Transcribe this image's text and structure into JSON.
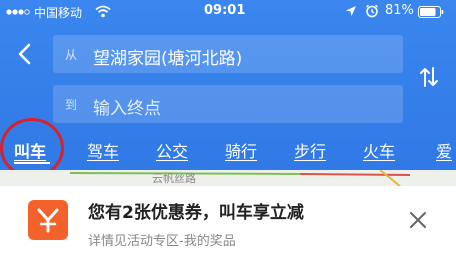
{
  "status_bar": {
    "carrier": "中国移动",
    "time": "09:01",
    "battery": "81%"
  },
  "search": {
    "from_prefix": "从",
    "from_value": "望湖家园(塘河北路)",
    "to_prefix": "到",
    "to_placeholder": "输入终点"
  },
  "tabs": [
    {
      "label": "叫车",
      "active": true
    },
    {
      "label": "驾车",
      "active": false
    },
    {
      "label": "公交",
      "active": false
    },
    {
      "label": "骑行",
      "active": false
    },
    {
      "label": "步行",
      "active": false
    },
    {
      "label": "火车",
      "active": false
    },
    {
      "label": "爱",
      "active": false
    }
  ],
  "map": {
    "road_label": "云帆丝路"
  },
  "coupon": {
    "title": "您有2张优惠券，叫车享立减",
    "subtitle": "详情见活动专区-我的奖品"
  },
  "colors": {
    "header_blue": "#3a86ee",
    "coupon_orange": "#f4622b",
    "highlight_red": "#d8222a"
  }
}
